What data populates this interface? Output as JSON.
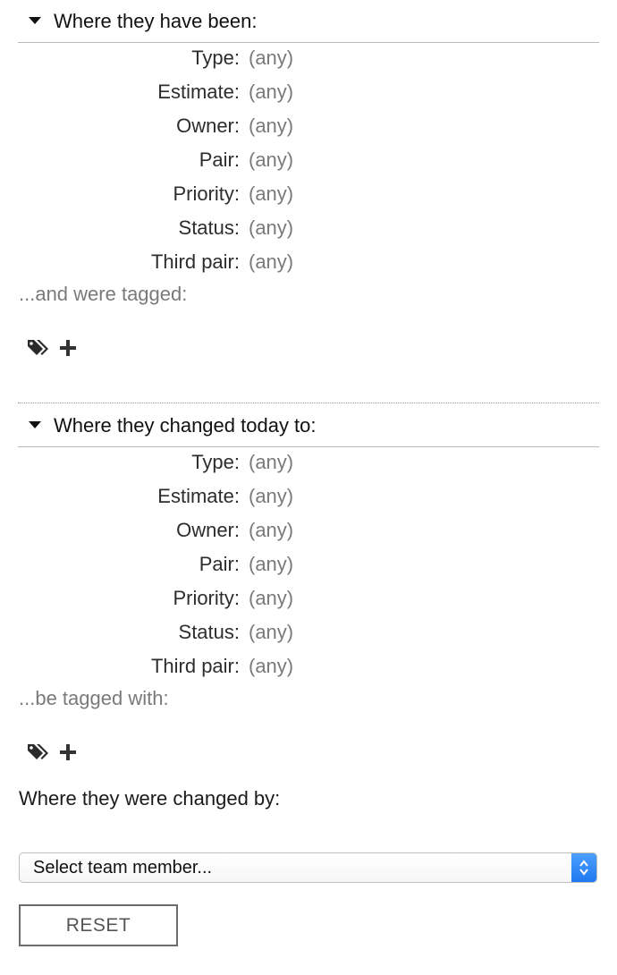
{
  "section1": {
    "title": "Where they have been:",
    "fields": [
      {
        "label": "Type:",
        "value": "(any)"
      },
      {
        "label": "Estimate:",
        "value": "(any)"
      },
      {
        "label": "Owner:",
        "value": "(any)"
      },
      {
        "label": "Pair:",
        "value": "(any)"
      },
      {
        "label": "Priority:",
        "value": "(any)"
      },
      {
        "label": "Status:",
        "value": "(any)"
      },
      {
        "label": "Third pair:",
        "value": "(any)"
      }
    ],
    "tag_note": "...and were tagged:"
  },
  "section2": {
    "title": "Where they changed today to:",
    "fields": [
      {
        "label": "Type:",
        "value": "(any)"
      },
      {
        "label": "Estimate:",
        "value": "(any)"
      },
      {
        "label": "Owner:",
        "value": "(any)"
      },
      {
        "label": "Pair:",
        "value": "(any)"
      },
      {
        "label": "Priority:",
        "value": "(any)"
      },
      {
        "label": "Status:",
        "value": "(any)"
      },
      {
        "label": "Third pair:",
        "value": "(any)"
      }
    ],
    "tag_note": "...be tagged with:"
  },
  "changed_by": {
    "label": "Where they were changed by:",
    "select_value": "Select team member..."
  },
  "reset_label": "RESET",
  "icons": {
    "tags": "tags-icon",
    "add": "plus-icon",
    "collapse": "caret-down-icon",
    "select": "up-down-arrows-icon"
  },
  "colors": {
    "accent": "#1f78f0"
  }
}
